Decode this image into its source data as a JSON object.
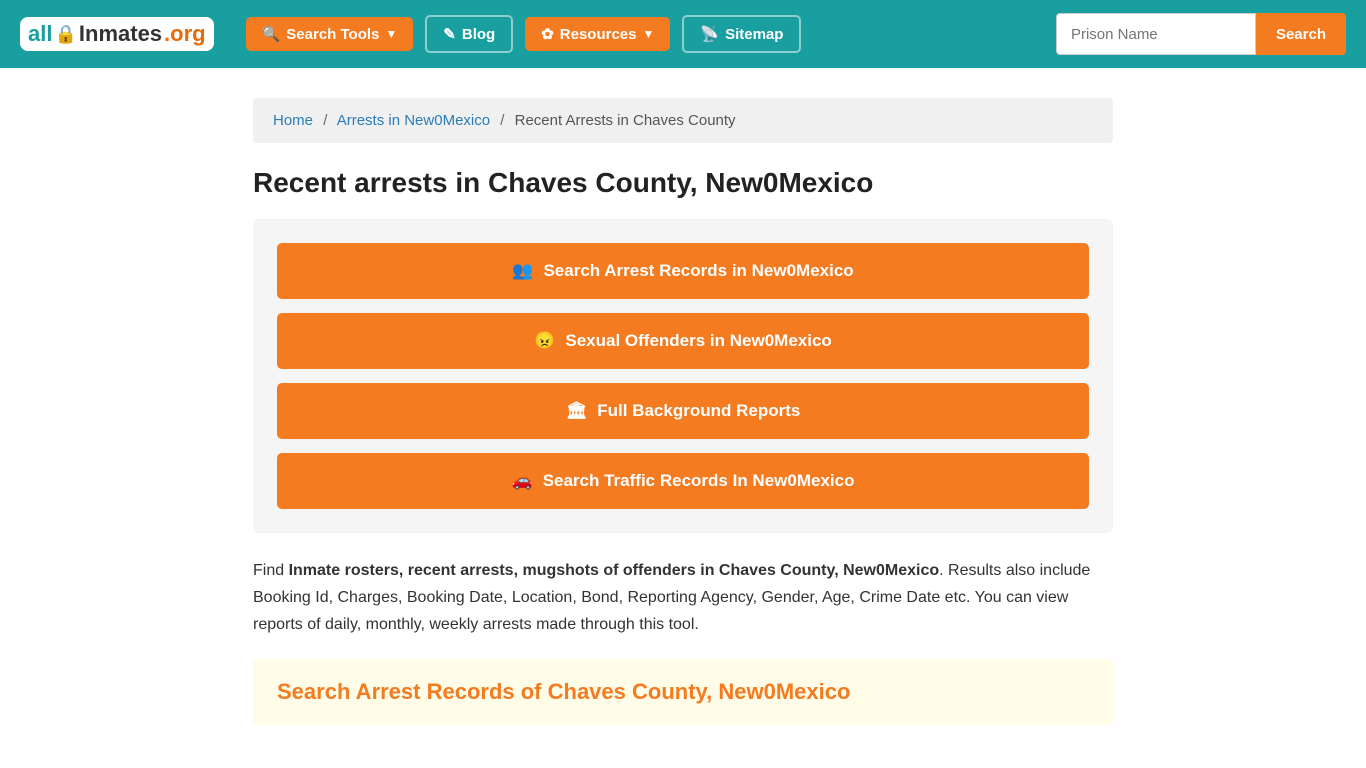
{
  "header": {
    "logo": {
      "part1": "all",
      "part2": "Inmates",
      "part3": ".org"
    },
    "nav": [
      {
        "id": "search-tools",
        "label": "Search Tools",
        "icon": "🔍",
        "hasDropdown": true,
        "type": "orange"
      },
      {
        "id": "blog",
        "label": "Blog",
        "icon": "✎",
        "hasDropdown": false,
        "type": "teal"
      },
      {
        "id": "resources",
        "label": "Resources",
        "icon": "✿",
        "hasDropdown": true,
        "type": "orange"
      },
      {
        "id": "sitemap",
        "label": "Sitemap",
        "icon": "📡",
        "hasDropdown": false,
        "type": "teal"
      }
    ],
    "search": {
      "placeholder": "Prison Name",
      "button_label": "Search"
    }
  },
  "breadcrumb": {
    "home": "Home",
    "arrests": "Arrests in New0Mexico",
    "current": "Recent Arrests in Chaves County"
  },
  "page": {
    "title": "Recent arrests in Chaves County, New0Mexico",
    "buttons": [
      {
        "id": "arrest-records",
        "icon": "👥",
        "label": "Search Arrest Records in New0Mexico"
      },
      {
        "id": "sexual-offenders",
        "icon": "😠",
        "label": "Sexual Offenders in New0Mexico"
      },
      {
        "id": "background-reports",
        "icon": "🏛",
        "label": "Full Background Reports"
      },
      {
        "id": "traffic-records",
        "icon": "🚗",
        "label": "Search Traffic Records In New0Mexico"
      }
    ],
    "description_plain": "Find ",
    "description_bold": "Inmate rosters, recent arrests, mugshots of offenders in Chaves County, New0Mexico",
    "description_rest": ". Results also include Booking Id, Charges, Booking Date, Location, Bond, Reporting Agency, Gender, Age, Crime Date etc. You can view reports of daily, monthly, weekly arrests made through this tool.",
    "bottom_heading": "Search Arrest Records of Chaves County, New0Mexico"
  }
}
